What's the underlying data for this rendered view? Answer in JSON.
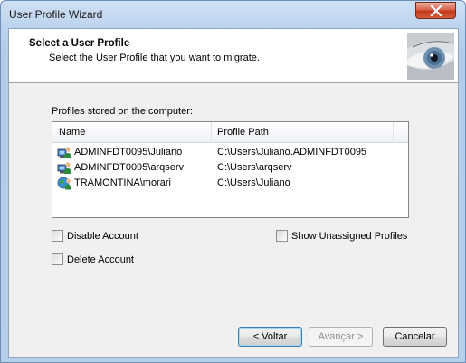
{
  "window": {
    "title": "User Profile Wizard"
  },
  "header": {
    "title": "Select a User Profile",
    "subtitle": "Select the User Profile that you want to migrate."
  },
  "profiles": {
    "label": "Profiles stored on the computer:",
    "columns": {
      "name": "Name",
      "path": "Profile Path"
    },
    "rows": [
      {
        "name": "ADMINFDT0095\\Juliano",
        "path": "C:\\Users\\Juliano.ADMINFDT0095",
        "icon": "user-computer-icon"
      },
      {
        "name": "ADMINFDT0095\\arqserv",
        "path": "C:\\Users\\arqserv",
        "icon": "user-computer-icon"
      },
      {
        "name": "TRAMONTINA\\morari",
        "path": "C:\\Users\\Juliano",
        "icon": "domain-user-icon"
      }
    ]
  },
  "options": {
    "disable_account": "Disable Account",
    "delete_account": "Delete Account",
    "show_unassigned": "Show Unassigned Profiles"
  },
  "buttons": {
    "back": "< Voltar",
    "next": "Avançar >",
    "cancel": "Cancelar"
  }
}
